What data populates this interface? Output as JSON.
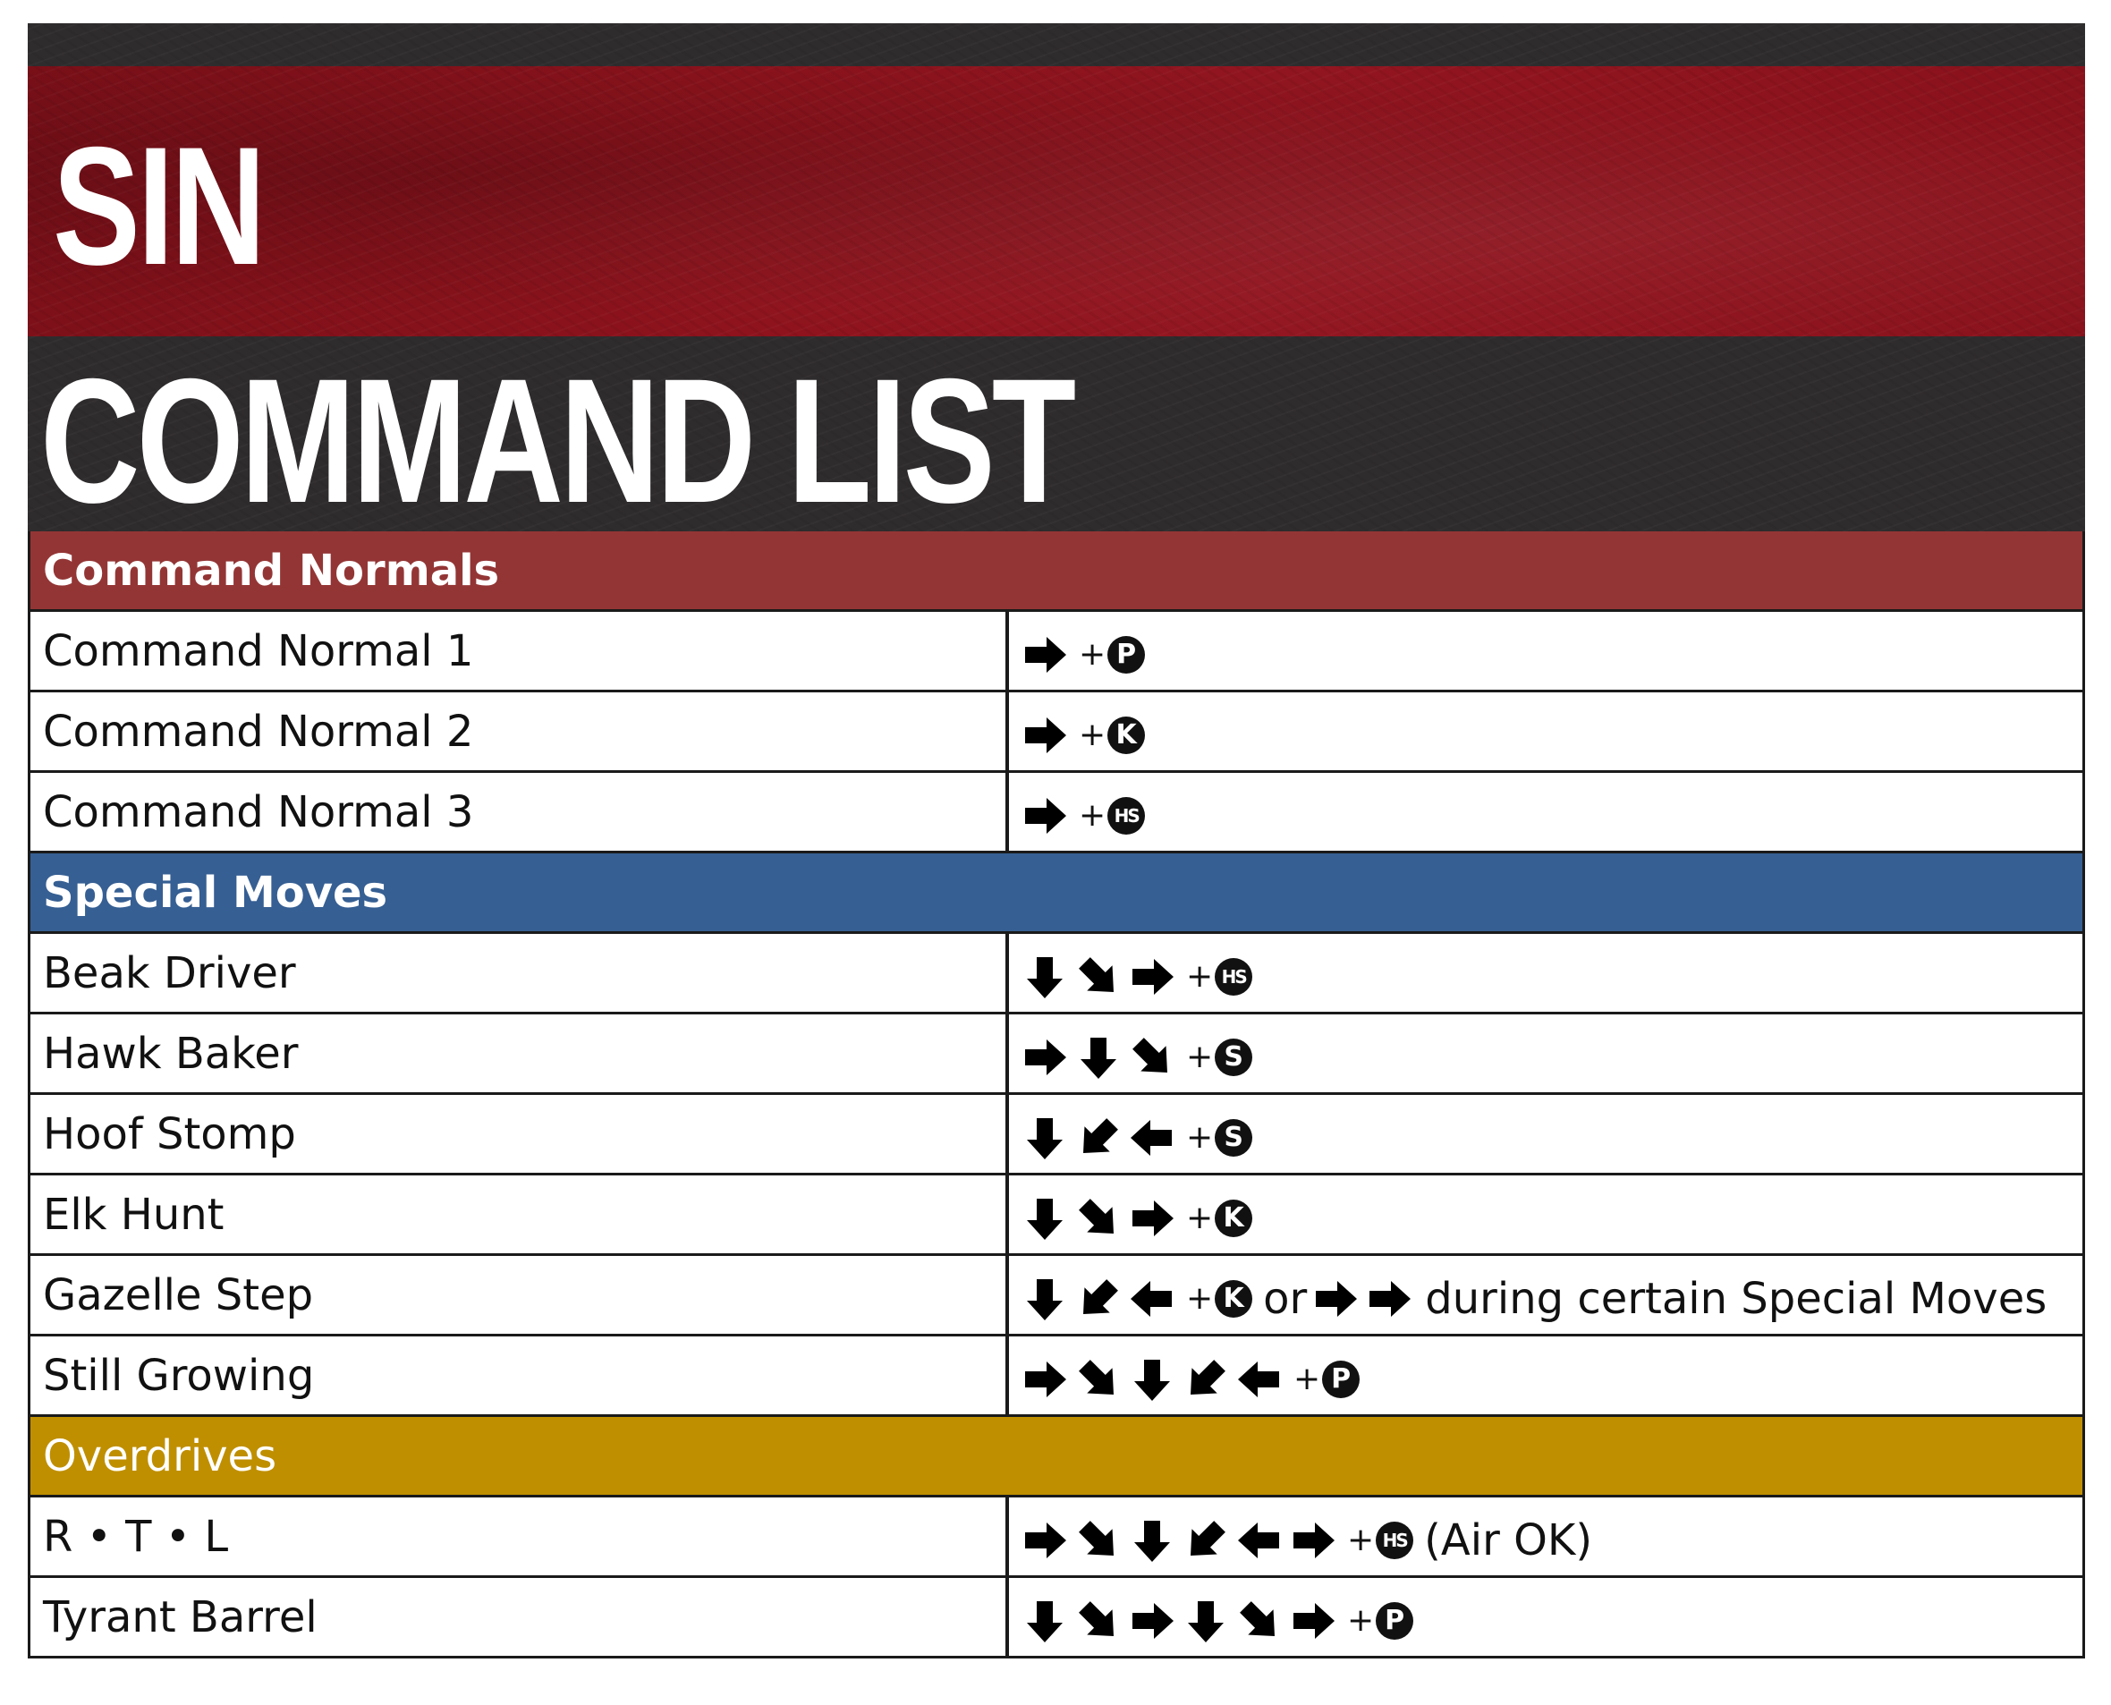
{
  "header": {
    "title_line1": "SIN",
    "title_line2": "COMMAND LIST"
  },
  "sections": [
    {
      "title": "Command Normals",
      "color": "#943535",
      "bold": true,
      "rows": [
        {
          "name": "Command Normal 1",
          "command": [
            {
              "a": "right"
            },
            {
              "plus": "+"
            },
            {
              "btn": "P"
            }
          ]
        },
        {
          "name": "Command Normal 2",
          "command": [
            {
              "a": "right"
            },
            {
              "plus": "+"
            },
            {
              "btn": "K"
            }
          ]
        },
        {
          "name": "Command Normal 3",
          "command": [
            {
              "a": "right"
            },
            {
              "plus": "+"
            },
            {
              "btn": "HS"
            }
          ]
        }
      ]
    },
    {
      "title": "Special Moves",
      "color": "#365f93",
      "bold": true,
      "rows": [
        {
          "name": "Beak Driver",
          "command": [
            {
              "a": "down"
            },
            {
              "a": "down-right"
            },
            {
              "a": "right"
            },
            {
              "plus": "+"
            },
            {
              "btn": "HS"
            }
          ]
        },
        {
          "name": "Hawk Baker",
          "command": [
            {
              "a": "right"
            },
            {
              "a": "down"
            },
            {
              "a": "down-right"
            },
            {
              "plus": "+"
            },
            {
              "btn": "S"
            }
          ]
        },
        {
          "name": "Hoof Stomp",
          "command": [
            {
              "a": "down"
            },
            {
              "a": "down-left"
            },
            {
              "a": "left"
            },
            {
              "plus": "+"
            },
            {
              "btn": "S"
            }
          ]
        },
        {
          "name": "Elk Hunt",
          "command": [
            {
              "a": "down"
            },
            {
              "a": "down-right"
            },
            {
              "a": "right"
            },
            {
              "plus": "+"
            },
            {
              "btn": "K"
            }
          ]
        },
        {
          "name": "Gazelle Step",
          "command": [
            {
              "a": "down"
            },
            {
              "a": "down-left"
            },
            {
              "a": "left"
            },
            {
              "plus": "+"
            },
            {
              "btn": "K"
            },
            {
              "text": "or"
            },
            {
              "a": "right"
            },
            {
              "a": "right"
            },
            {
              "text": "during certain Special Moves"
            }
          ]
        },
        {
          "name": "Still Growing",
          "command": [
            {
              "a": "right"
            },
            {
              "a": "down-right"
            },
            {
              "a": "down"
            },
            {
              "a": "down-left"
            },
            {
              "a": "left"
            },
            {
              "plus": "+"
            },
            {
              "btn": "P"
            }
          ]
        }
      ]
    },
    {
      "title": "Overdrives",
      "color": "#bf8f00",
      "bold": false,
      "rows": [
        {
          "name": "R • T • L",
          "command": [
            {
              "a": "right"
            },
            {
              "a": "down-right"
            },
            {
              "a": "down"
            },
            {
              "a": "down-left"
            },
            {
              "a": "left"
            },
            {
              "a": "right"
            },
            {
              "plus": "+"
            },
            {
              "btn": "HS"
            },
            {
              "text": "(Air OK)"
            }
          ]
        },
        {
          "name": "Tyrant Barrel",
          "command": [
            {
              "a": "down"
            },
            {
              "a": "down-right"
            },
            {
              "a": "right"
            },
            {
              "a": "down"
            },
            {
              "a": "down-right"
            },
            {
              "a": "right"
            },
            {
              "plus": "+"
            },
            {
              "btn": "P"
            }
          ]
        }
      ]
    }
  ],
  "icons": {
    "right": "right-arrow-icon",
    "down": "down-arrow-icon",
    "down-right": "down-right-arrow-icon",
    "down-left": "down-left-arrow-icon",
    "left": "left-arrow-icon"
  }
}
